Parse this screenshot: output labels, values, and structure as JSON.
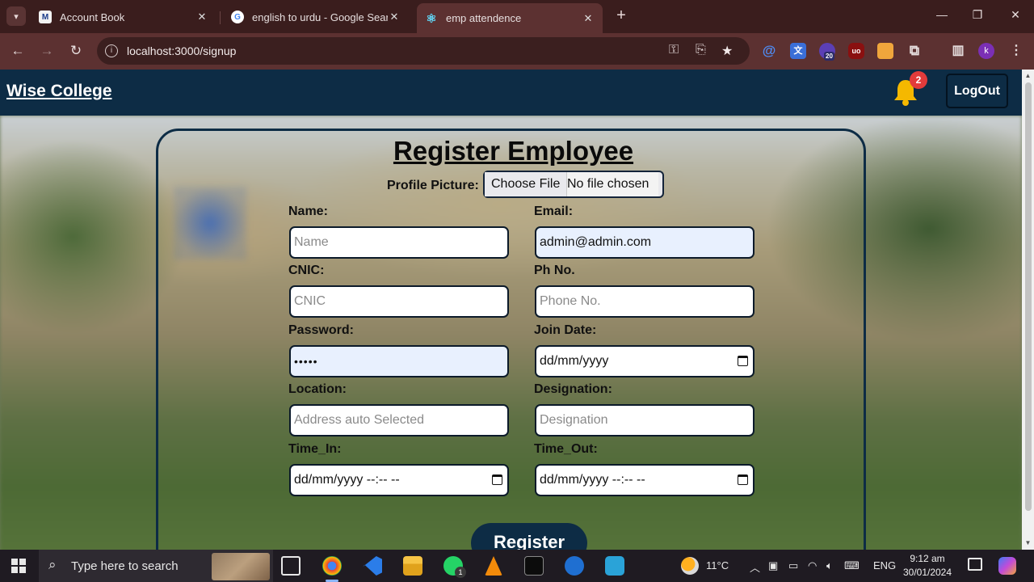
{
  "browser": {
    "tabs": [
      {
        "title": "Account Book",
        "favicon": "M",
        "active": false
      },
      {
        "title": "english to urdu - Google Searc",
        "favicon": "G",
        "active": false
      },
      {
        "title": "emp attendence",
        "favicon": "⚛",
        "active": true
      }
    ],
    "new_tab": "+",
    "url": "localhost:3000/signup",
    "extension_badge": "20",
    "profile_initial": "k"
  },
  "app": {
    "brand": "Wise College",
    "notification_count": "2",
    "logout_label": "LogOut"
  },
  "form": {
    "title": "Register Employee",
    "profile_picture_label": "Profile Picture:",
    "choose_file": "Choose File",
    "no_file": "No file chosen",
    "fields": {
      "name": {
        "label": "Name:",
        "placeholder": "Name",
        "value": ""
      },
      "email": {
        "label": "Email:",
        "placeholder": "",
        "value": "admin@admin.com"
      },
      "cnic": {
        "label": "CNIC:",
        "placeholder": "CNIC",
        "value": ""
      },
      "phone": {
        "label": "Ph No.",
        "placeholder": "Phone No.",
        "value": ""
      },
      "password": {
        "label": "Password:",
        "value": "•••••"
      },
      "join_date": {
        "label": "Join Date:",
        "value": "dd/mm/yyyy"
      },
      "location": {
        "label": "Location:",
        "placeholder": "Address auto Selected",
        "value": ""
      },
      "designation": {
        "label": "Designation:",
        "placeholder": "Designation",
        "value": ""
      },
      "time_in": {
        "label": "Time_In:",
        "value": "dd/mm/yyyy --:-- --"
      },
      "time_out": {
        "label": "Time_Out:",
        "value": "dd/mm/yyyy --:-- --"
      }
    },
    "submit_label": "Register"
  },
  "taskbar": {
    "search_placeholder": "Type here to search",
    "whatsapp_badge": "1",
    "weather": "11°C",
    "language": "ENG",
    "time": "9:12 am",
    "date": "30/01/2024"
  },
  "colors": {
    "appbar": "#0d2c45",
    "browser_frame": "#3a1d1d",
    "badge": "#e23b3b",
    "autofill": "#e8f0fe"
  }
}
